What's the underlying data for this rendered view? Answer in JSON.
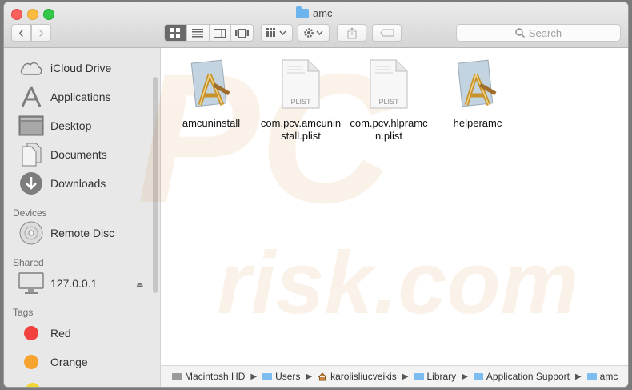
{
  "window": {
    "title": "amc"
  },
  "toolbar": {
    "back_glyph": "‹",
    "forward_glyph": "›",
    "search_placeholder": "Search"
  },
  "sidebar": {
    "favorites": [
      {
        "label": "iCloud Drive",
        "icon": "cloud-icon"
      },
      {
        "label": "Applications",
        "icon": "applications-icon"
      },
      {
        "label": "Desktop",
        "icon": "desktop-icon"
      },
      {
        "label": "Documents",
        "icon": "document-icon"
      },
      {
        "label": "Downloads",
        "icon": "download-icon"
      }
    ],
    "devices_header": "Devices",
    "devices": [
      {
        "label": "Remote Disc",
        "icon": "disc-icon"
      }
    ],
    "shared_header": "Shared",
    "shared": [
      {
        "label": "127.0.0.1",
        "icon": "monitor-icon"
      }
    ],
    "tags_header": "Tags",
    "tags": [
      {
        "label": "Red",
        "color": "#f2423f"
      },
      {
        "label": "Orange",
        "color": "#f6a330"
      }
    ]
  },
  "files": [
    {
      "name": "amcuninstall",
      "kind": "app"
    },
    {
      "name": "com.pcv.amcuninstall.plist",
      "line1": "com.pcv.amcunin",
      "line2": "stall.plist",
      "kind": "plist",
      "badge": "PLIST"
    },
    {
      "name": "com.pcv.hlpramcn.plist",
      "line1": "com.pcv.hlpramc",
      "line2": "n.plist",
      "kind": "plist",
      "badge": "PLIST"
    },
    {
      "name": "helperamc",
      "kind": "app"
    }
  ],
  "pathbar": [
    {
      "label": "Macintosh HD",
      "icon": "hard-drive-icon"
    },
    {
      "label": "Users",
      "icon": "folder-icon"
    },
    {
      "label": "karolisliucveikis",
      "icon": "home-icon"
    },
    {
      "label": "Library",
      "icon": "folder-icon"
    },
    {
      "label": "Application Support",
      "icon": "folder-icon"
    },
    {
      "label": "amc",
      "icon": "folder-icon"
    }
  ],
  "path_separator": "▶",
  "watermark": {
    "text": "risk.com",
    "logo": "PC"
  }
}
